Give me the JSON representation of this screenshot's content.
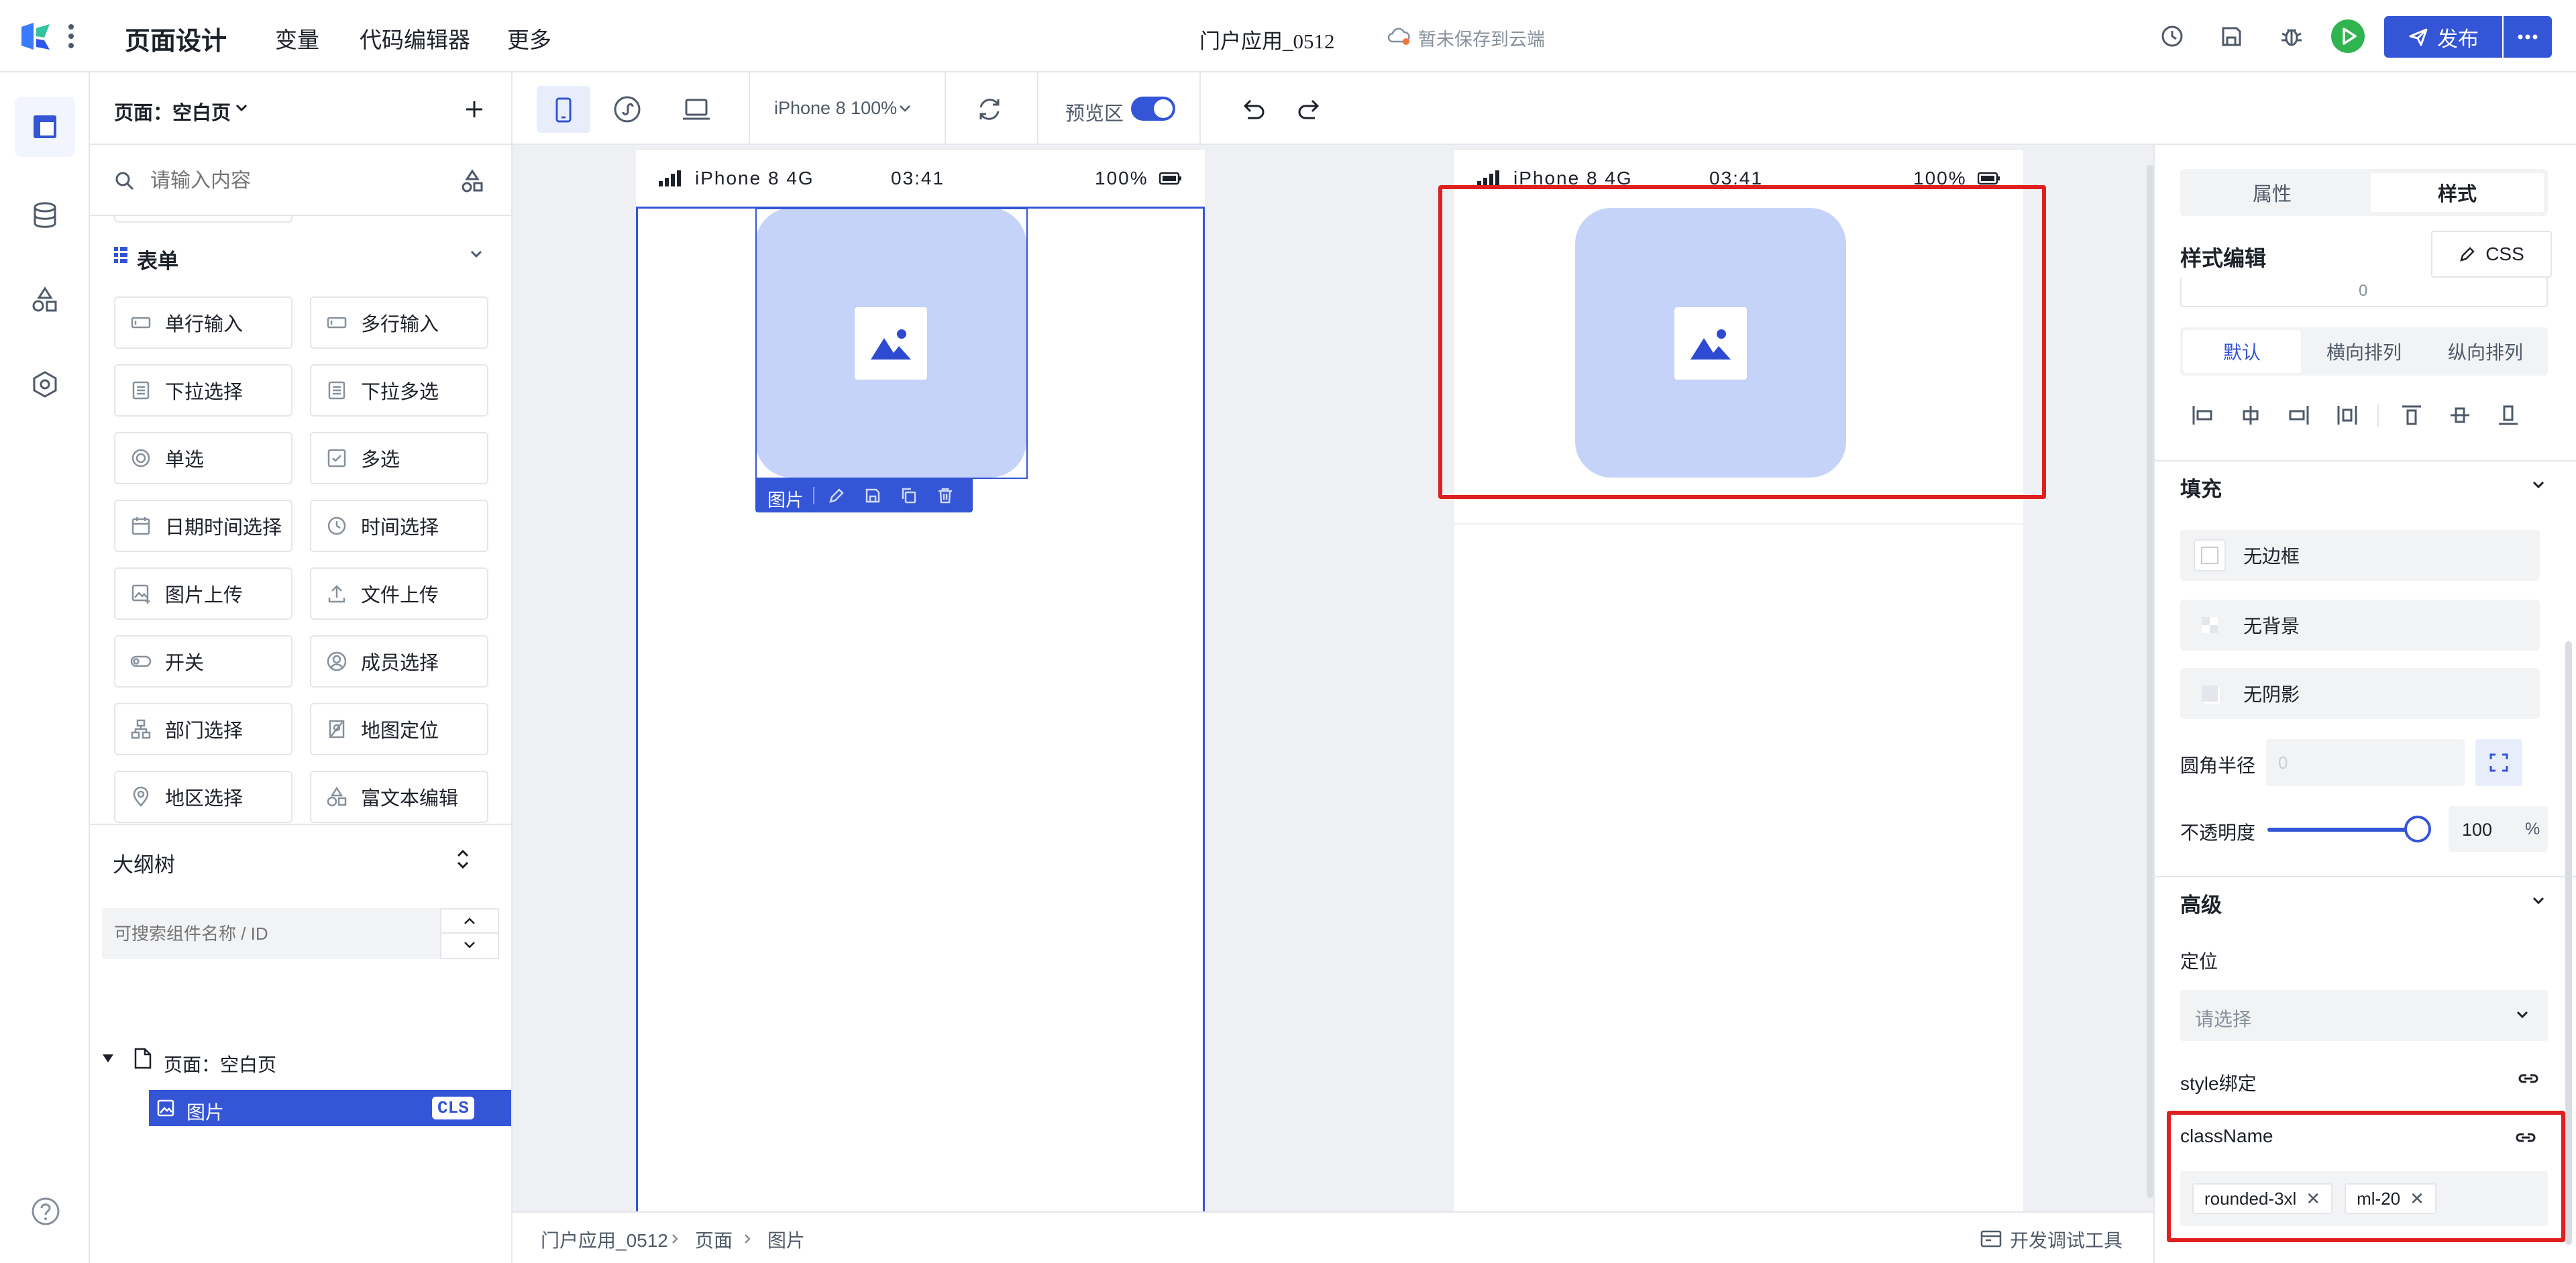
{
  "topbar": {
    "title": "页面设计",
    "nav": [
      "变量",
      "代码编辑器",
      "更多"
    ],
    "app_name": "门户应用_0512",
    "cloud_status": "暂未保存到云端",
    "publish_label": "发布",
    "accent": "#3355d6",
    "run_color": "#2fb44f"
  },
  "left": {
    "page_label": "页面：空白页",
    "search_placeholder": "请输入内容",
    "form_section": "表单",
    "components": [
      "单行输入",
      "多行输入",
      "下拉选择",
      "下拉多选",
      "单选",
      "多选",
      "日期时间选择",
      "时间选择",
      "图片上传",
      "文件上传",
      "开关",
      "成员选择",
      "部门选择",
      "地图定位",
      "地区选择",
      "富文本编辑"
    ],
    "outline_title": "大纲树",
    "outline_search_placeholder": "可搜索组件名称 / ID",
    "tree_page": "页面：空白页",
    "tree_image": "图片",
    "tree_image_badge": "CLS"
  },
  "toolbar": {
    "device": "iPhone 8 100%",
    "preview_label": "预览区"
  },
  "phone": {
    "carrier": "iPhone 8  4G",
    "time": "03:41",
    "battery": "100%",
    "image_label": "图片"
  },
  "right": {
    "tabs": [
      "属性",
      "样式"
    ],
    "active_tab": "样式",
    "style_edit_title": "样式编辑",
    "css_label": "CSS",
    "zero_value": "0",
    "layout_tabs": [
      "默认",
      "横向排列",
      "纵向排列"
    ],
    "fill_section": "填充",
    "fill_items": [
      "无边框",
      "无背景",
      "无阴影"
    ],
    "radius_label": "圆角半径",
    "radius_value": "0",
    "opacity_label": "不透明度",
    "opacity_value": "100",
    "opacity_unit": "%",
    "opacity_level": 100,
    "advanced_section": "高级",
    "position_label": "定位",
    "position_placeholder": "请选择",
    "style_bind_label": "style绑定",
    "classname_label": "className",
    "classname_chips": [
      "rounded-3xl",
      "ml-20"
    ]
  },
  "bottom": {
    "breadcrumb": [
      "门户应用_0512",
      "页面",
      "图片"
    ],
    "devtools_label": "开发调试工具"
  },
  "colors": {
    "image_bg": "#c5d3f8",
    "image_icon": "#2c4bd1",
    "highlight_red": "#e02020"
  }
}
